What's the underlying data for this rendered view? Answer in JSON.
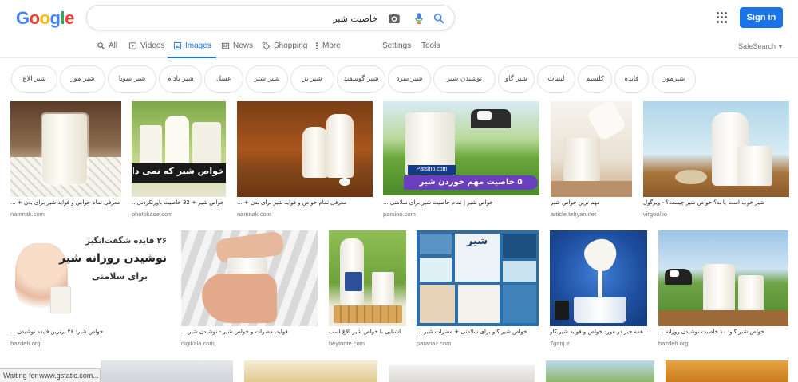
{
  "logo": {
    "letters": [
      "G",
      "o",
      "o",
      "g",
      "l",
      "e"
    ]
  },
  "search": {
    "query": "خاصیت شیر"
  },
  "icons": {
    "camera": "camera-icon",
    "mic": "microphone-icon",
    "search": "search-icon",
    "apps": "apps-grid-icon"
  },
  "header": {
    "signin_label": "Sign in"
  },
  "tabs": [
    {
      "label": "All",
      "icon": "search-icon"
    },
    {
      "label": "Videos",
      "icon": "video-icon"
    },
    {
      "label": "Images",
      "icon": "image-icon",
      "active": true
    },
    {
      "label": "News",
      "icon": "news-icon"
    },
    {
      "label": "Shopping",
      "icon": "tag-icon"
    },
    {
      "label": "More",
      "icon": "more-vert-icon"
    },
    {
      "label": "Settings"
    },
    {
      "label": "Tools"
    }
  ],
  "safesearch": {
    "label": "SafeSearch"
  },
  "chips": [
    "شیرمور",
    "فایده",
    "کلسیم",
    "لبنیات",
    "شیر گاو",
    "نوشیدن شیر",
    "شیر سرد",
    "شیر گوسفند",
    "شیر بز",
    "شیر شتر",
    "عسل",
    "شیر بادام",
    "شیر سویا",
    "شیر مور",
    "شیر الاغ"
  ],
  "results": [
    {
      "title": "معرفی تمام خواص و فواید شیر برای بدن + ...",
      "site": "namnak.com"
    },
    {
      "title": "خواص شیر + 32 خاصیت باورنکردنی...",
      "site": "photokade.com",
      "overlay": "خواص شیر که نمی دانید"
    },
    {
      "title": "معرفی تمام خواص و فواید شیر برای بدن + ...",
      "site": "namnak.com"
    },
    {
      "title": "خواص شیر | تمام خاصیت شیر برای سلامتی ...",
      "site": "parsino.com",
      "overlay": "۵ خاصیت مهم خوردن شیر",
      "overlay_brand": "Parsino.com"
    },
    {
      "title": "مهم ترین خواص شیر",
      "site": "article.tebyan.net"
    },
    {
      "title": "شیر خوب است یا بد؟ خواص شیر چیست؟ - ویرگول",
      "site": "virgool.io"
    },
    {
      "title": "خواص شیر: ۲۶ برترین فایده نوشیدن ...",
      "site": "bazdeh.org",
      "overlay_lines": [
        "۲۶ فایده شگفت‌انگیز",
        "نوشیدن روزانه شیر",
        "برای سلامتی"
      ]
    },
    {
      "title": "فواید، مضرات و خواص شیر - نوشیدن شیر ...",
      "site": "digikala.com"
    },
    {
      "title": "آشنایی با خواص شیر الاغ اسب",
      "site": "beytoote.com"
    },
    {
      "title": "خواص شیر گاو برای سلامتی + مضرات شیر ...",
      "site": "paranaz.com",
      "overlay": "شیر"
    },
    {
      "title": "همه چیز در مورد خواص و فواید شیر گاو",
      "site": "7ganj.ir"
    },
    {
      "title": "خواص شیر گاو: ۱۰ خاصیت نوشیدن روزانه ...",
      "site": "bazdeh.org"
    }
  ],
  "status": {
    "text": "Waiting for www.gstatic.com..."
  },
  "colors": {
    "accent": "#1a73e8",
    "background": "#ffffff",
    "text": "#202124"
  }
}
